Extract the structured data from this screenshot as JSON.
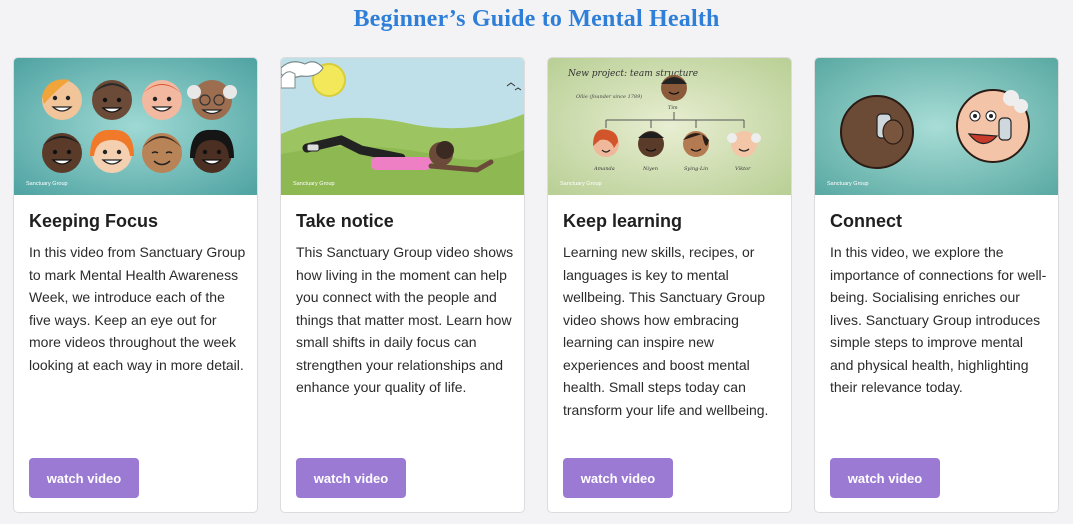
{
  "page": {
    "title": "Beginner’s Guide to Mental Health"
  },
  "colors": {
    "title": "#2f7fd8",
    "button": "#9b7ad4",
    "card_bg": "#ffffff",
    "page_bg": "#f3f3f5"
  },
  "cards": [
    {
      "title": "Keeping Focus",
      "description": "In this video from Sanctuary Group to mark Mental Health Awareness Week, we introduce each of the five ways. Keep an eye out for more videos throughout the week looking at each way in more detail.",
      "button": "watch video",
      "thumb_logo": "Sanctuary Group"
    },
    {
      "title": "Take notice",
      "description": "This Sanctuary Group video shows how living in the moment can help you connect with the people and things that matter most. Learn how small shifts in daily focus can strengthen your relationships and enhance your quality of life.",
      "button": "watch video",
      "thumb_logo": "Sanctuary Group"
    },
    {
      "title": "Keep learning",
      "description": "Learning new skills, recipes, or languages is key to mental wellbeing. This Sanctuary Group video shows how embracing learning can inspire new experiences and boost mental health. Small steps today can transform your life and wellbeing.",
      "button": "watch video",
      "thumb_logo": "Sanctuary Group",
      "thumb_heading": "New project: team structure",
      "thumb_subnote": "Ollie (founder since 1789)",
      "thumb_root": "Tim",
      "thumb_members": [
        "Amanda",
        "Niyen",
        "Sying-Lin",
        "Viktor"
      ]
    },
    {
      "title": "Connect",
      "description": "In this video, we explore the importance of connections for well-being. Socialising enriches our lives. Sanctuary Group introduces simple steps to improve mental and physical health, highlighting their relevance today.",
      "button": "watch video",
      "thumb_logo": "Sanctuary Group"
    }
  ]
}
